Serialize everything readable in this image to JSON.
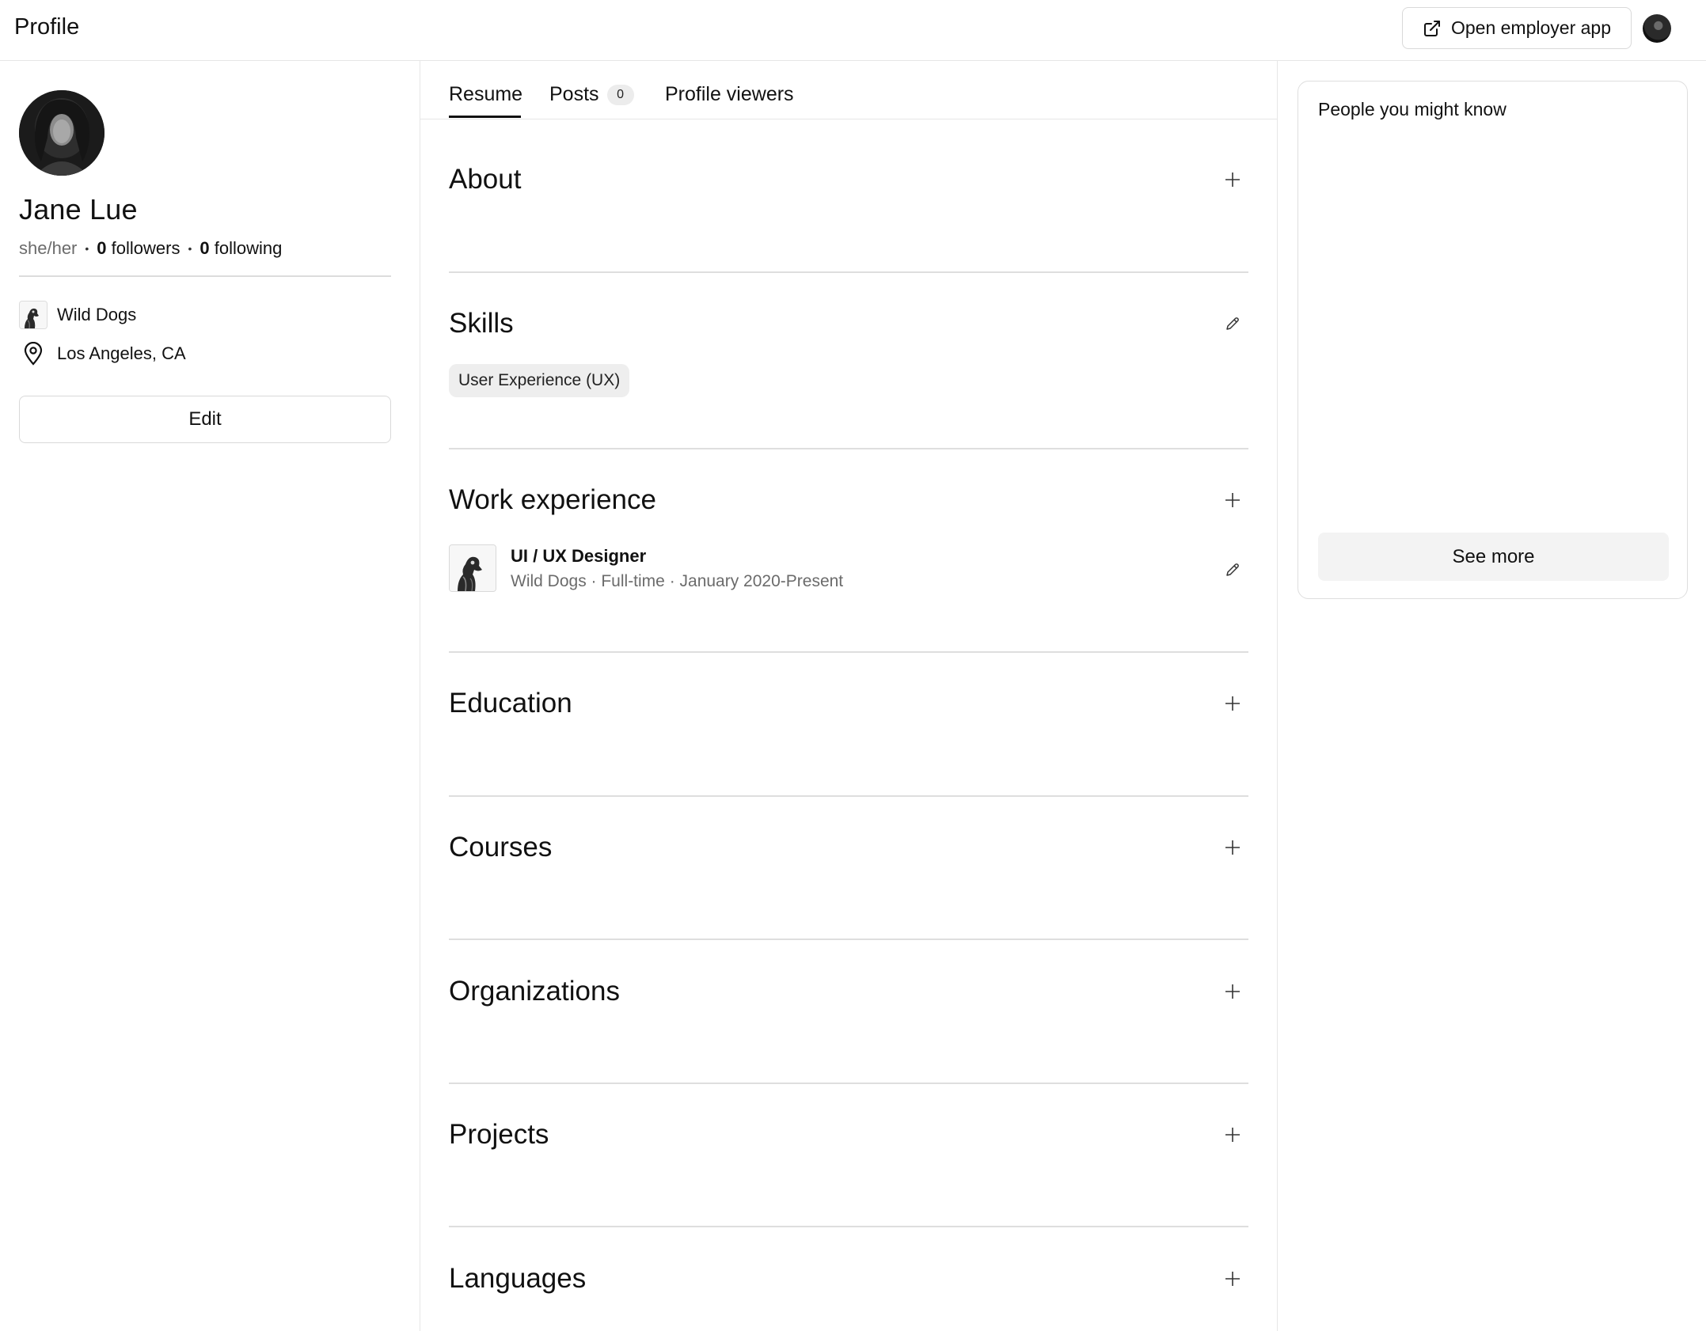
{
  "header": {
    "title": "Profile",
    "employer_button_label": "Open employer app"
  },
  "profile": {
    "name": "Jane Lue",
    "pronouns": "she/her",
    "followers_count": "0",
    "followers_label": "followers",
    "following_count": "0",
    "following_label": "following",
    "company": "Wild Dogs",
    "location": "Los Angeles, CA",
    "edit_label": "Edit"
  },
  "tabs": [
    {
      "label": "Resume",
      "active": true
    },
    {
      "label": "Posts",
      "badge": "0"
    },
    {
      "label": "Profile viewers"
    }
  ],
  "sections": {
    "about": {
      "title": "About",
      "action_icon": "plus-icon"
    },
    "skills": {
      "title": "Skills",
      "action_icon": "pencil-icon",
      "items": [
        "User Experience (UX)"
      ]
    },
    "work_experience": {
      "title": "Work experience",
      "action_icon": "plus-icon",
      "items": [
        {
          "title": "UI / UX Designer",
          "subtitle": "Wild Dogs · Full-time · January 2020-Present"
        }
      ]
    },
    "education": {
      "title": "Education",
      "action_icon": "plus-icon"
    },
    "courses": {
      "title": "Courses",
      "action_icon": "plus-icon"
    },
    "organizations": {
      "title": "Organizations",
      "action_icon": "plus-icon"
    },
    "projects": {
      "title": "Projects",
      "action_icon": "plus-icon"
    },
    "languages": {
      "title": "Languages",
      "action_icon": "plus-icon"
    }
  },
  "people_you_might_know": {
    "title": "People you might know",
    "see_more_label": "See more"
  },
  "colors": {
    "text": "#111111",
    "muted_text": "#6b6b6b",
    "border": "#dedede",
    "chip_bg": "#eeeeee",
    "button_bg": "#f3f3f3"
  }
}
